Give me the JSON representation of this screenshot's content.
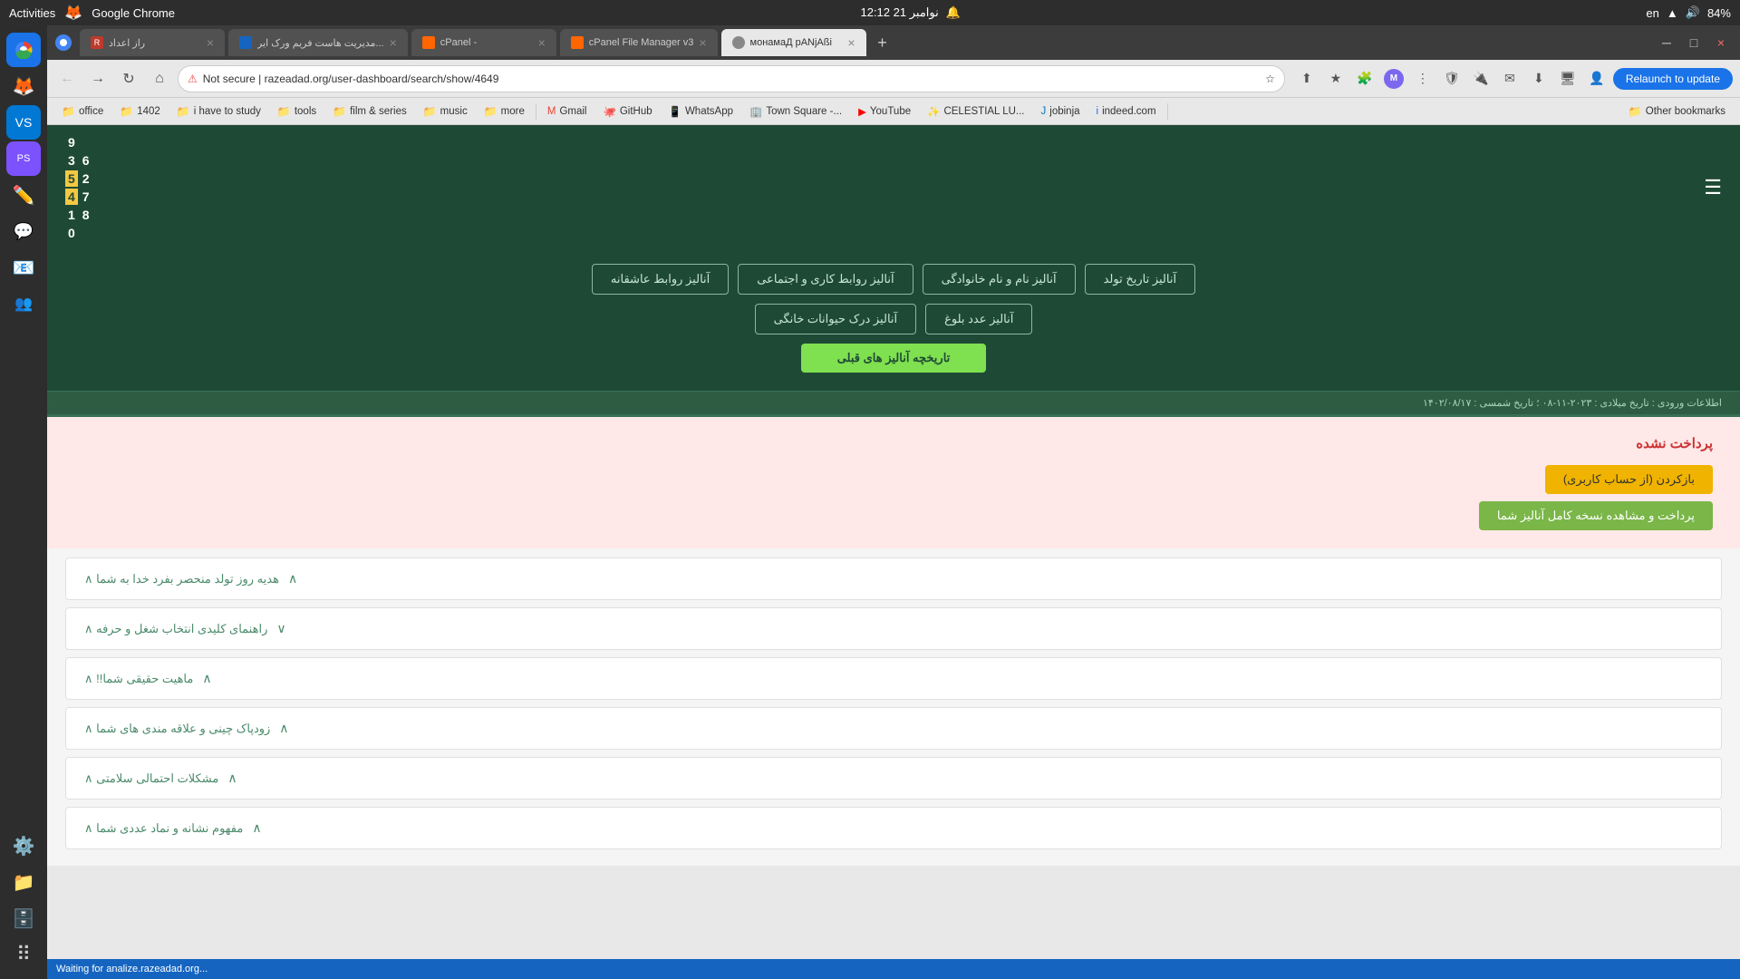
{
  "os": {
    "activities_label": "Activities",
    "app_name": "Google Chrome",
    "time": "12:12",
    "date": "21 نوامبر",
    "lang": "en",
    "battery": "84%"
  },
  "browser": {
    "tabs": [
      {
        "id": "tab1",
        "title": "راز اعداد",
        "favicon_color": "#e94235",
        "active": false
      },
      {
        "id": "tab2",
        "title": "مدیریت هاست فریم ورک ایر...",
        "favicon_color": "#1565C0",
        "active": false
      },
      {
        "id": "tab3",
        "title": "cPanel -",
        "favicon_color": "#ff6600",
        "active": false
      },
      {
        "id": "tab4",
        "title": "cPanel File Manager v3",
        "favicon_color": "#ff6600",
        "active": false
      },
      {
        "id": "tab5",
        "title": "монамаД рАNjАßi",
        "favicon_color": "#888",
        "active": true
      }
    ],
    "url": "Not secure | razeadad.org/user-dashboard/search/show/4649",
    "relaunch_label": "Relaunch to update"
  },
  "bookmarks": [
    {
      "id": "bm1",
      "label": "office",
      "type": "folder"
    },
    {
      "id": "bm2",
      "label": "1402",
      "type": "folder"
    },
    {
      "id": "bm3",
      "label": "i have to study",
      "type": "folder"
    },
    {
      "id": "bm4",
      "label": "tools",
      "type": "folder"
    },
    {
      "id": "bm5",
      "label": "film & series",
      "type": "folder"
    },
    {
      "id": "bm6",
      "label": "music",
      "type": "folder"
    },
    {
      "id": "bm7",
      "label": "more",
      "type": "folder"
    },
    {
      "id": "bm8",
      "label": "Gmail",
      "type": "link"
    },
    {
      "id": "bm9",
      "label": "GitHub",
      "type": "link"
    },
    {
      "id": "bm10",
      "label": "WhatsApp",
      "type": "link"
    },
    {
      "id": "bm11",
      "label": "Town Square -...",
      "type": "link"
    },
    {
      "id": "bm12",
      "label": "YouTube",
      "type": "link"
    },
    {
      "id": "bm13",
      "label": "CELESTIAL LU...",
      "type": "link"
    },
    {
      "id": "bm14",
      "label": "jobinja",
      "type": "link"
    },
    {
      "id": "bm15",
      "label": "indeed.com",
      "type": "link"
    },
    {
      "id": "bm16",
      "label": "Other bookmarks",
      "type": "folder"
    }
  ],
  "website": {
    "logo_numbers": [
      {
        "val": "9",
        "style": "plain"
      },
      {
        "val": "",
        "style": "empty"
      },
      {
        "val": "3",
        "style": "plain"
      },
      {
        "val": "6",
        "style": "plain"
      },
      {
        "val": "5",
        "style": "yellow"
      },
      {
        "val": "2",
        "style": "plain"
      },
      {
        "val": "4",
        "style": "yellow"
      },
      {
        "val": "7",
        "style": "plain"
      },
      {
        "val": "1",
        "style": "plain"
      },
      {
        "val": "8",
        "style": "plain"
      },
      {
        "val": "0",
        "style": "plain"
      }
    ],
    "analysis_buttons": [
      "آنالیز روابط عاشقانه",
      "آنالیز روابط کاری و اجتماعی",
      "آنالیز نام و نام خانوادگی",
      "آنالیز تاریخ تولد",
      "آنالیز درک حیوانات خانگی",
      "آنالیز عدد بلوغ"
    ],
    "history_btn": "تاریخچه آنالیز های قبلی",
    "info_text": "اطلاعات ورودی : تاریخ میلادی : ۲۰۲۳-۱۱-۰۸ ؛ تاریخ شمسی : ۱۴۰۲/۰۸/۱۷",
    "payment_section": {
      "title": "پرداخت نشده",
      "reactivate_btn": "بازکردن (از حساب کاربری)",
      "pay_btn": "پرداخت و مشاهده نسخه کامل آنالیز شما"
    },
    "sections": [
      {
        "title": "هدیه روز تولد منحصر بفرد خدا به شما ∧"
      },
      {
        "title": "راهنمای کلیدی انتخاب شغل و حرفه ∧"
      },
      {
        "title": "ماهیت حقیقی شما!! ∧"
      },
      {
        "title": "زودپاک چینی و علاقه مندی های شما ∧"
      },
      {
        "title": "مشکلات احتمالی سلامتی ∧"
      },
      {
        "title": "مفهوم نشانه و نماد عددی شما ∧"
      }
    ]
  },
  "status_bar": {
    "text": "Waiting for analize.razeadad.org..."
  }
}
